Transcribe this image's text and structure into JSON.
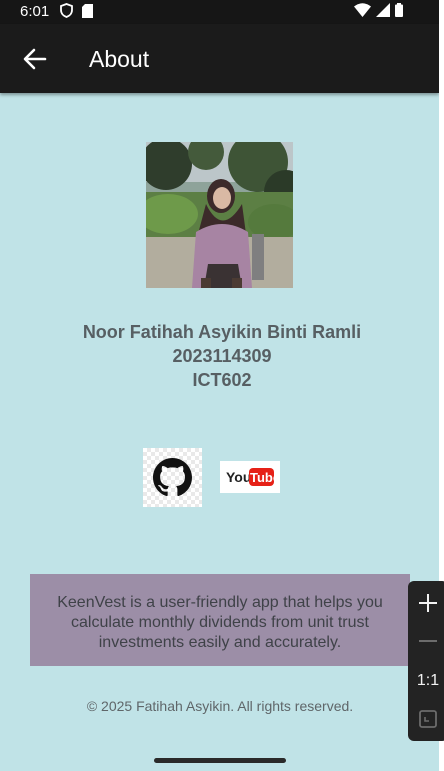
{
  "status_bar": {
    "time": "6:01",
    "left_icons": [
      "shield-icon",
      "sd-card-icon"
    ],
    "right_icons": [
      "wifi-icon",
      "cell-signal-icon",
      "battery-icon"
    ]
  },
  "app_bar": {
    "title": "About",
    "back_icon": "arrow-left-icon"
  },
  "profile": {
    "photo_alt": "Profile photo",
    "name": "Noor Fatihah Asyikin Binti Ramli",
    "student_id": "2023114309",
    "course": "ICT602"
  },
  "links": {
    "github": {
      "icon": "github-icon"
    },
    "youtube": {
      "logo_you": "You",
      "logo_tube": "Tube"
    }
  },
  "about": {
    "description": "KeenVest is a user-friendly app that helps you calculate monthly dividends from unit trust investments easily and accurately."
  },
  "footer": {
    "copyright": "© 2025 Fatihah Asyikin. All rights reserved."
  },
  "zoom_controls": {
    "zoom_in": "+",
    "zoom_out": "—",
    "actual_size": "1:1"
  },
  "colors": {
    "background": "#c0e3e7",
    "app_bar": "#1b1b1b",
    "about_card": "#9c8ea7",
    "text_primary": "#575f63",
    "youtube_red": "#e62117"
  }
}
